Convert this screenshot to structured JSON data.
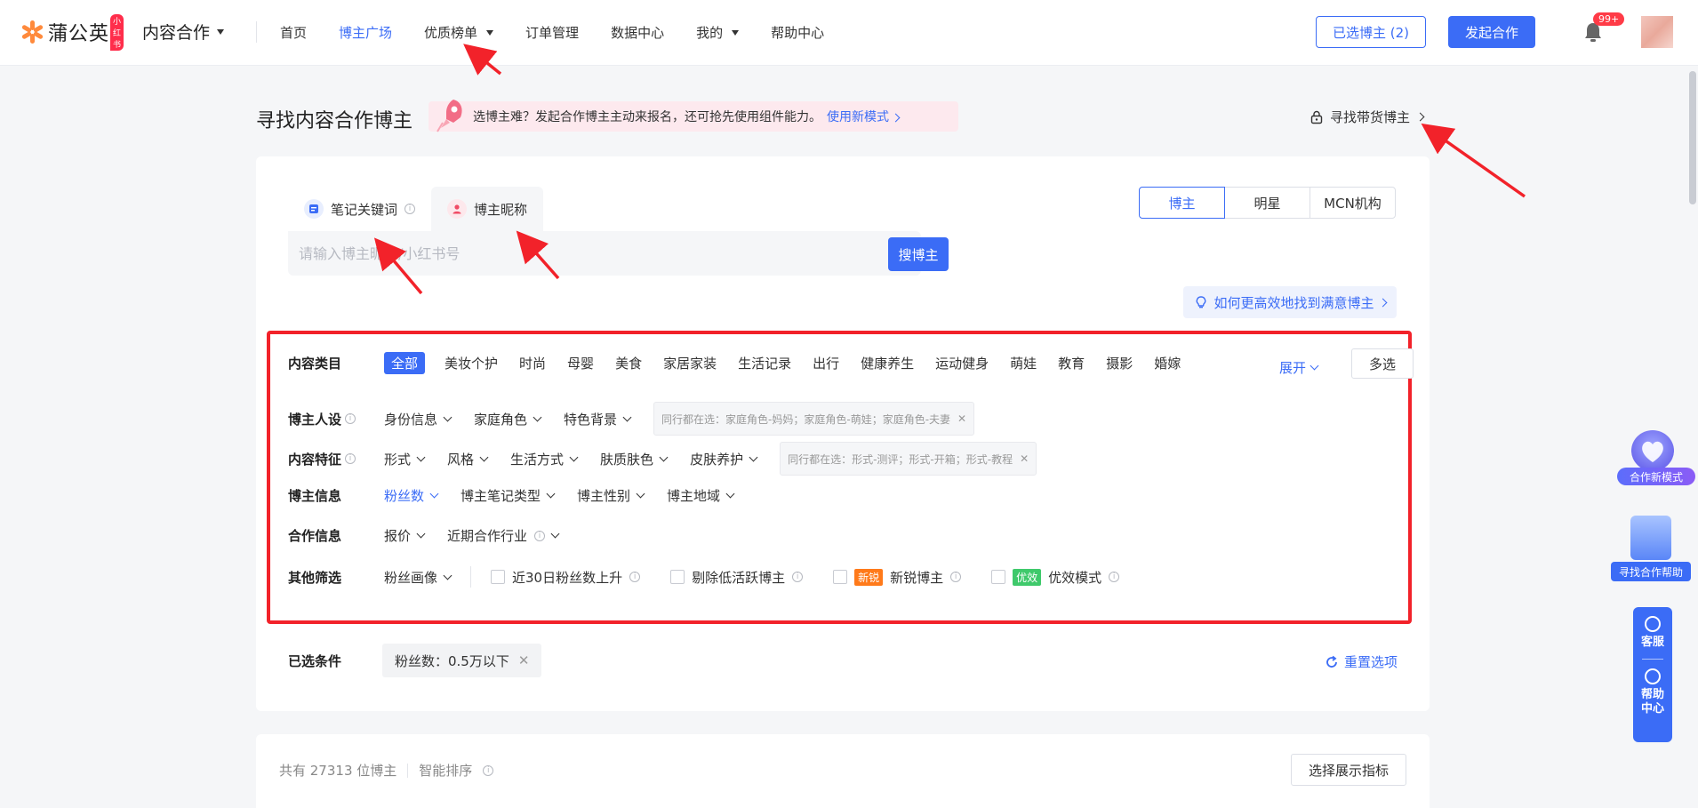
{
  "brand": {
    "name": "蒲公英",
    "badge": "小红书",
    "app_switch": "内容合作"
  },
  "nav": {
    "items": [
      {
        "label": "首页",
        "active": false,
        "dropdown": false
      },
      {
        "label": "博主广场",
        "active": true,
        "dropdown": false
      },
      {
        "label": "优质榜单",
        "active": false,
        "dropdown": true
      },
      {
        "label": "订单管理",
        "active": false,
        "dropdown": false
      },
      {
        "label": "数据中心",
        "active": false,
        "dropdown": false
      },
      {
        "label": "我的",
        "active": false,
        "dropdown": true
      },
      {
        "label": "帮助中心",
        "active": false,
        "dropdown": false
      }
    ],
    "selected_bloggers": "已选博主 (2)",
    "start_coop": "发起合作",
    "notif_count": "99+"
  },
  "header": {
    "title": "寻找内容合作博主",
    "promo_text": "选博主难？发起合作博主主动来报名，还可抢先使用组件能力。",
    "promo_link": "使用新模式",
    "find_goods": "寻找带货博主"
  },
  "search": {
    "tabs": [
      {
        "label": "笔记关键词",
        "active": false
      },
      {
        "label": "博主昵称",
        "active": true
      }
    ],
    "placeholder": "请输入博主昵称/小红书号",
    "button": "搜博主",
    "types": [
      {
        "label": "博主",
        "active": true
      },
      {
        "label": "明星",
        "active": false
      },
      {
        "label": "MCN机构",
        "active": false
      }
    ],
    "tip_link": "如何更高效地找到满意博主"
  },
  "filters": {
    "content_category": {
      "label": "内容类目",
      "items": [
        "全部",
        "美妆个护",
        "时尚",
        "母婴",
        "美食",
        "家居家装",
        "生活记录",
        "出行",
        "健康养生",
        "运动健身",
        "萌娃",
        "教育",
        "摄影",
        "婚嫁"
      ],
      "expand": "展开",
      "multi": "多选"
    },
    "persona": {
      "label": "博主人设",
      "dropdowns": [
        "身份信息",
        "家庭角色",
        "特色背景"
      ],
      "hint": "同行都在选：家庭角色-妈妈；家庭角色-萌娃；家庭角色-夫妻"
    },
    "features": {
      "label": "内容特征",
      "dropdowns": [
        "形式",
        "风格",
        "生活方式",
        "肤质肤色",
        "皮肤养护"
      ],
      "hint": "同行都在选：形式-测评；形式-开箱；形式-教程"
    },
    "blogger_info": {
      "label": "博主信息",
      "dropdowns": [
        "粉丝数",
        "博主笔记类型",
        "博主性别",
        "博主地域"
      ]
    },
    "coop_info": {
      "label": "合作信息",
      "dropdowns": [
        "报价",
        "近期合作行业"
      ]
    },
    "other": {
      "label": "其他筛选",
      "dropdown": "粉丝画像",
      "checks": [
        "近30日粉丝数上升",
        "剔除低活跃博主",
        "新锐博主",
        "优效模式"
      ],
      "tag_new": "新锐",
      "tag_good": "优效"
    }
  },
  "selected": {
    "label": "已选条件",
    "chip": "粉丝数：0.5万以下",
    "reset": "重置选项"
  },
  "results": {
    "count_text": "共有 27313 位博主",
    "sort": "智能排序",
    "choose_metrics": "选择展示指标"
  },
  "floating": {
    "coop_new": "合作新模式",
    "find_help": "寻找合作帮助",
    "service": "客服",
    "help_center": "帮助中心"
  }
}
